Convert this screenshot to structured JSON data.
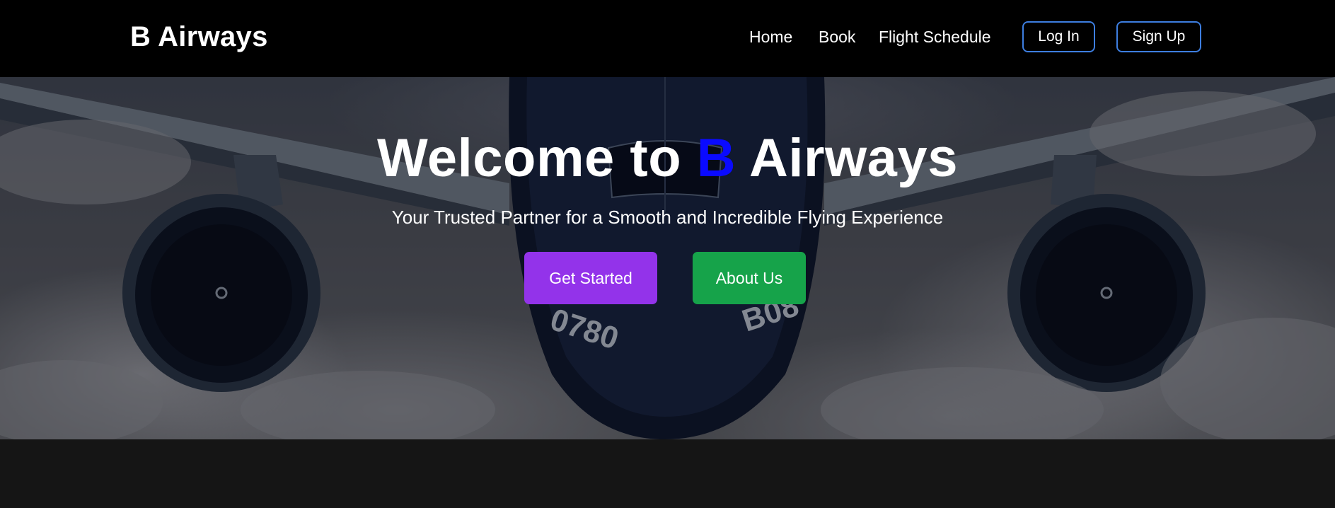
{
  "brand": {
    "name": "B Airways"
  },
  "nav": {
    "links": [
      {
        "label": "Home"
      },
      {
        "label": "Book"
      },
      {
        "label": "Flight Schedule"
      }
    ],
    "login_label": "Log In",
    "signup_label": "Sign Up"
  },
  "hero": {
    "title_prefix": "Welcome to",
    "title_accent": "B",
    "title_suffix": "Airways",
    "subtitle": "Your Trusted Partner for a Smooth and Incredible Flying Experience",
    "primary_cta": "Get Started",
    "secondary_cta": "About Us",
    "background_image": "airplane-in-clouds",
    "aircraft_markings": [
      "0780",
      "B08"
    ]
  },
  "colors": {
    "navbar_bg": "#000000",
    "nav_button_border": "#3d7ee0",
    "title_accent": "#0a0aff",
    "primary_cta_bg": "#9333ea",
    "secondary_cta_bg": "#16a34a",
    "footer_bg": "#151515"
  }
}
